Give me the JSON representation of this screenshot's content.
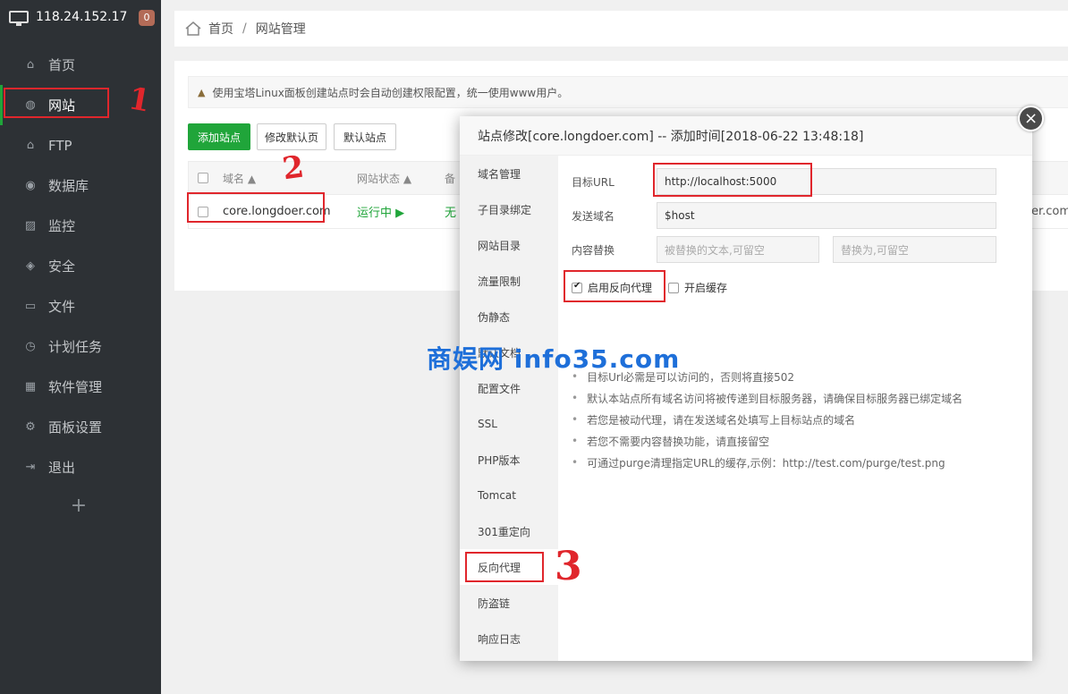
{
  "sidebar": {
    "server_ip": "118.24.152.17",
    "badge": "0",
    "items": [
      {
        "label": "首页",
        "icon": "home-icon"
      },
      {
        "label": "网站",
        "icon": "globe-icon"
      },
      {
        "label": "FTP",
        "icon": "ftp-icon"
      },
      {
        "label": "数据库",
        "icon": "database-icon"
      },
      {
        "label": "监控",
        "icon": "monitor-icon"
      },
      {
        "label": "安全",
        "icon": "shield-icon"
      },
      {
        "label": "文件",
        "icon": "folder-icon"
      },
      {
        "label": "计划任务",
        "icon": "clock-icon"
      },
      {
        "label": "软件管理",
        "icon": "apps-icon"
      },
      {
        "label": "面板设置",
        "icon": "gear-icon"
      },
      {
        "label": "退出",
        "icon": "logout-icon"
      }
    ],
    "add": "+"
  },
  "breadcrumb": {
    "home": "首页",
    "sep": "/",
    "current": "网站管理"
  },
  "notice": "使用宝塔Linux面板创建站点时会自动创建权限配置，统一使用www用户。",
  "buttons": {
    "add_site": "添加站点",
    "edit_default_page": "修改默认页",
    "default_site": "默认站点"
  },
  "table": {
    "headers": {
      "domain": "域名 ▲",
      "status": "网站状态 ▲",
      "backup": "备"
    },
    "row": {
      "domain": "core.longdoer.com",
      "status": "运行中 ▶",
      "backup": "无",
      "tail": "er.com"
    }
  },
  "modal": {
    "title": "站点修改[core.longdoer.com] -- 添加时间[2018-06-22 13:48:18]",
    "close": "×",
    "tabs": [
      "域名管理",
      "子目录绑定",
      "网站目录",
      "流量限制",
      "伪静态",
      "默认文档",
      "配置文件",
      "SSL",
      "PHP版本",
      "Tomcat",
      "301重定向",
      "反向代理",
      "防盗链",
      "响应日志"
    ],
    "form": {
      "target_url_label": "目标URL",
      "target_url_value": "http://localhost:5000",
      "send_domain_label": "发送域名",
      "send_domain_value": "$host",
      "replace_label": "内容替换",
      "replace_from_placeholder": "被替换的文本,可留空",
      "replace_to_placeholder": "替换为,可留空",
      "enable_proxy_label": "启用反向代理",
      "enable_cache_label": "开启缓存"
    },
    "tips": [
      "目标Url必需是可以访问的，否则将直接502",
      "默认本站点所有域名访问将被传递到目标服务器，请确保目标服务器已绑定域名",
      "若您是被动代理，请在发送域名处填写上目标站点的域名",
      "若您不需要内容替换功能，请直接留空",
      "可通过purge清理指定URL的缓存,示例：http://test.com/purge/test.png"
    ]
  },
  "watermark": "商娱网 info35.com",
  "annotations": {
    "one": "1",
    "two": "2",
    "three": "3"
  },
  "colors": {
    "accent": "#20a53a",
    "sidebar_bg": "#2d3135",
    "annotation": "#e0262c"
  }
}
